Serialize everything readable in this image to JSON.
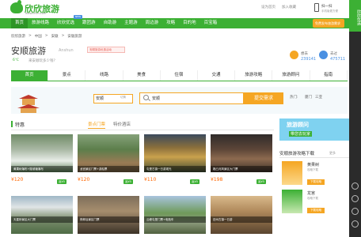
{
  "header": {
    "logo": "欣欣旅游",
    "logo_sub": "www.cncn.com",
    "top_links": [
      "设为首页",
      "加入收藏"
    ],
    "app_title": "扫一扫",
    "app_sub": "手机版更方便"
  },
  "nav": {
    "items": [
      "首页",
      "旅游线路",
      "欣欣优选",
      "跟团游",
      "自助游",
      "主题游",
      "周边游",
      "攻略",
      "目的地",
      "百宝箱"
    ],
    "new_badge": "NEW",
    "right_label": "免费发布旅游需求"
  },
  "breadcrumb": [
    "欣欣旅游",
    ">",
    "中国",
    ">",
    "安徽",
    ">",
    "安徽旅游"
  ],
  "title": {
    "name": "安顺旅游",
    "en": "Anshun",
    "promo": "安顺旅游优惠活动",
    "weather": "6℃",
    "question": "来安顺玩多少钱?"
  },
  "stats": {
    "want_label": "想去",
    "want_val": "239141",
    "been_label": "去过",
    "been_val": "475711"
  },
  "tabs": [
    "首页",
    "景点",
    "线路",
    "美食",
    "住宿",
    "交通",
    "旅游攻略",
    "旅游顾问",
    "指南"
  ],
  "search": {
    "city": "安顺",
    "city_switch": "切换",
    "query": "安顺",
    "button": "提交需求",
    "hot_label": "热门:",
    "hot_items": [
      "厦门",
      "三亚"
    ]
  },
  "section": {
    "title": "特惠",
    "tab1": "景点门票",
    "tab2": "特价酒店"
  },
  "cards": [
    {
      "caption": "黄果树瀑布+陡坡塘瀑布",
      "price": "¥120",
      "tag": "返¥5"
    },
    {
      "caption": "龙宫景区门票+游船票",
      "price": "¥120",
      "tag": "返¥5"
    },
    {
      "caption": "屯堡古镇一日游观光",
      "price": "¥110",
      "tag": "返¥5"
    },
    {
      "caption": "格凸河风景区大门票",
      "price": "¥198",
      "tag": "返¥5"
    },
    {
      "caption": "天星桥景区大门票",
      "price": "¥120",
      "tag": ""
    },
    {
      "caption": "夜郎谷景区门票",
      "price": "¥120",
      "tag": ""
    },
    {
      "caption": "云峰屯堡门票+电瓶车",
      "price": "¥120",
      "tag": ""
    },
    {
      "caption": "旧州古镇一日游",
      "price": "¥120",
      "tag": ""
    }
  ],
  "promo": {
    "line1": "旅游顾问",
    "line2": "带您去玩家"
  },
  "guide": {
    "title": "安顺旅游攻略下载",
    "more": "更多",
    "items": [
      {
        "name": "黄果树",
        "sub": "攻略下载",
        "dl": "下载攻略"
      },
      {
        "name": "龙宫",
        "sub": "攻略下载",
        "dl": "下载攻略"
      }
    ]
  },
  "sidebar": {
    "top": "欣欣优选"
  },
  "colors": {
    "brand": "#3cb034",
    "accent": "#f5a623"
  }
}
